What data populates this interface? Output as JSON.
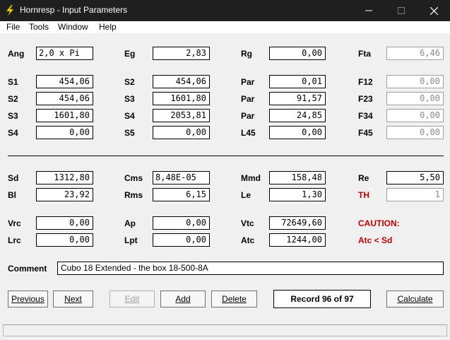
{
  "window": {
    "title": "Hornresp - Input Parameters"
  },
  "menu": {
    "file": "File",
    "tools": "Tools",
    "window": "Window",
    "help": "Help"
  },
  "row1": {
    "ang_label": "Ang",
    "ang_value": "2,0 x Pi",
    "eg_label": "Eg",
    "eg_value": "2,83",
    "rg_label": "Rg",
    "rg_value": "0,00",
    "fta_label": "Fta",
    "fta_value": "6,46"
  },
  "segments": {
    "col1": [
      {
        "label": "S1",
        "value": "454,06"
      },
      {
        "label": "S2",
        "value": "454,06"
      },
      {
        "label": "S3",
        "value": "1601,80"
      },
      {
        "label": "S4",
        "value": "0,00"
      }
    ],
    "col2": [
      {
        "label": "S2",
        "value": "454,06"
      },
      {
        "label": "S3",
        "value": "1601,80"
      },
      {
        "label": "S4",
        "value": "2053,81"
      },
      {
        "label": "S5",
        "value": "0,00"
      }
    ],
    "col3": [
      {
        "label": "Par",
        "value": "0,01"
      },
      {
        "label": "Par",
        "value": "91,57"
      },
      {
        "label": "Par",
        "value": "24,85"
      },
      {
        "label": "L45",
        "value": "0,00"
      }
    ],
    "col4": [
      {
        "label": "F12",
        "value": "0,00"
      },
      {
        "label": "F23",
        "value": "0,00"
      },
      {
        "label": "F34",
        "value": "0,00"
      },
      {
        "label": "F45",
        "value": "0,00"
      }
    ]
  },
  "driver": {
    "sd_label": "Sd",
    "sd_value": "1312,80",
    "cms_label": "Cms",
    "cms_value": "8,48E-05",
    "mmd_label": "Mmd",
    "mmd_value": "158,48",
    "re_label": "Re",
    "re_value": "5,50",
    "bl_label": "Bl",
    "bl_value": "23,92",
    "rms_label": "Rms",
    "rms_value": "6,15",
    "le_label": "Le",
    "le_value": "1,30",
    "th_label": "TH",
    "th_value": "1"
  },
  "chamber": {
    "vrc_label": "Vrc",
    "vrc_value": "0,00",
    "ap_label": "Ap",
    "ap_value": "0,00",
    "vtc_label": "Vtc",
    "vtc_value": "72649,60",
    "caution_label": "CAUTION:",
    "lrc_label": "Lrc",
    "lrc_value": "0,00",
    "lpt_label": "Lpt",
    "lpt_value": "0,00",
    "atc_label": "Atc",
    "atc_value": "1244,00",
    "warning": "Atc < Sd"
  },
  "comment": {
    "label": "Comment",
    "value": "Cubo 18 Extended - the box 18-500-8A"
  },
  "buttons": {
    "previous": "Previous",
    "next": "Next",
    "edit": "Edit",
    "add": "Add",
    "delete": "Delete",
    "record": "Record 96 of 97",
    "calculate": "Calculate"
  },
  "colors": {
    "titlebar": "#1f1f1f",
    "warning": "#c00000",
    "disabled_text": "#8a8a8a"
  },
  "icons": {
    "app": "lightning-bolt-icon",
    "minimize": "minimize-icon",
    "maximize": "maximize-icon",
    "close": "close-icon"
  }
}
